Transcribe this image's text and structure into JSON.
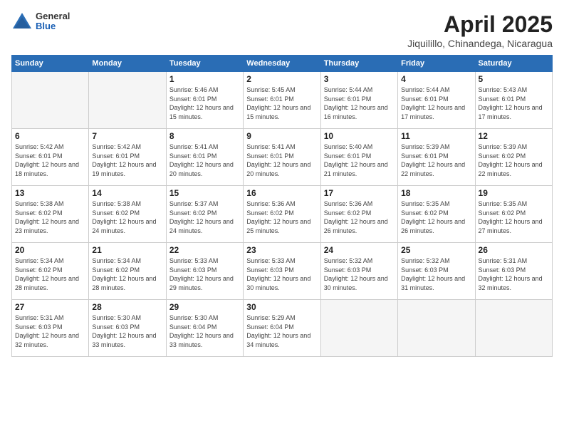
{
  "header": {
    "logo": {
      "general": "General",
      "blue": "Blue"
    },
    "title": "April 2025",
    "location": "Jiquilillo, Chinandega, Nicaragua"
  },
  "weekdays": [
    "Sunday",
    "Monday",
    "Tuesday",
    "Wednesday",
    "Thursday",
    "Friday",
    "Saturday"
  ],
  "weeks": [
    [
      {
        "day": "",
        "sunrise": "",
        "sunset": "",
        "daylight": "",
        "empty": true
      },
      {
        "day": "",
        "sunrise": "",
        "sunset": "",
        "daylight": "",
        "empty": true
      },
      {
        "day": "1",
        "sunrise": "Sunrise: 5:46 AM",
        "sunset": "Sunset: 6:01 PM",
        "daylight": "Daylight: 12 hours and 15 minutes.",
        "empty": false
      },
      {
        "day": "2",
        "sunrise": "Sunrise: 5:45 AM",
        "sunset": "Sunset: 6:01 PM",
        "daylight": "Daylight: 12 hours and 15 minutes.",
        "empty": false
      },
      {
        "day": "3",
        "sunrise": "Sunrise: 5:44 AM",
        "sunset": "Sunset: 6:01 PM",
        "daylight": "Daylight: 12 hours and 16 minutes.",
        "empty": false
      },
      {
        "day": "4",
        "sunrise": "Sunrise: 5:44 AM",
        "sunset": "Sunset: 6:01 PM",
        "daylight": "Daylight: 12 hours and 17 minutes.",
        "empty": false
      },
      {
        "day": "5",
        "sunrise": "Sunrise: 5:43 AM",
        "sunset": "Sunset: 6:01 PM",
        "daylight": "Daylight: 12 hours and 17 minutes.",
        "empty": false
      }
    ],
    [
      {
        "day": "6",
        "sunrise": "Sunrise: 5:42 AM",
        "sunset": "Sunset: 6:01 PM",
        "daylight": "Daylight: 12 hours and 18 minutes.",
        "empty": false
      },
      {
        "day": "7",
        "sunrise": "Sunrise: 5:42 AM",
        "sunset": "Sunset: 6:01 PM",
        "daylight": "Daylight: 12 hours and 19 minutes.",
        "empty": false
      },
      {
        "day": "8",
        "sunrise": "Sunrise: 5:41 AM",
        "sunset": "Sunset: 6:01 PM",
        "daylight": "Daylight: 12 hours and 20 minutes.",
        "empty": false
      },
      {
        "day": "9",
        "sunrise": "Sunrise: 5:41 AM",
        "sunset": "Sunset: 6:01 PM",
        "daylight": "Daylight: 12 hours and 20 minutes.",
        "empty": false
      },
      {
        "day": "10",
        "sunrise": "Sunrise: 5:40 AM",
        "sunset": "Sunset: 6:01 PM",
        "daylight": "Daylight: 12 hours and 21 minutes.",
        "empty": false
      },
      {
        "day": "11",
        "sunrise": "Sunrise: 5:39 AM",
        "sunset": "Sunset: 6:01 PM",
        "daylight": "Daylight: 12 hours and 22 minutes.",
        "empty": false
      },
      {
        "day": "12",
        "sunrise": "Sunrise: 5:39 AM",
        "sunset": "Sunset: 6:02 PM",
        "daylight": "Daylight: 12 hours and 22 minutes.",
        "empty": false
      }
    ],
    [
      {
        "day": "13",
        "sunrise": "Sunrise: 5:38 AM",
        "sunset": "Sunset: 6:02 PM",
        "daylight": "Daylight: 12 hours and 23 minutes.",
        "empty": false
      },
      {
        "day": "14",
        "sunrise": "Sunrise: 5:38 AM",
        "sunset": "Sunset: 6:02 PM",
        "daylight": "Daylight: 12 hours and 24 minutes.",
        "empty": false
      },
      {
        "day": "15",
        "sunrise": "Sunrise: 5:37 AM",
        "sunset": "Sunset: 6:02 PM",
        "daylight": "Daylight: 12 hours and 24 minutes.",
        "empty": false
      },
      {
        "day": "16",
        "sunrise": "Sunrise: 5:36 AM",
        "sunset": "Sunset: 6:02 PM",
        "daylight": "Daylight: 12 hours and 25 minutes.",
        "empty": false
      },
      {
        "day": "17",
        "sunrise": "Sunrise: 5:36 AM",
        "sunset": "Sunset: 6:02 PM",
        "daylight": "Daylight: 12 hours and 26 minutes.",
        "empty": false
      },
      {
        "day": "18",
        "sunrise": "Sunrise: 5:35 AM",
        "sunset": "Sunset: 6:02 PM",
        "daylight": "Daylight: 12 hours and 26 minutes.",
        "empty": false
      },
      {
        "day": "19",
        "sunrise": "Sunrise: 5:35 AM",
        "sunset": "Sunset: 6:02 PM",
        "daylight": "Daylight: 12 hours and 27 minutes.",
        "empty": false
      }
    ],
    [
      {
        "day": "20",
        "sunrise": "Sunrise: 5:34 AM",
        "sunset": "Sunset: 6:02 PM",
        "daylight": "Daylight: 12 hours and 28 minutes.",
        "empty": false
      },
      {
        "day": "21",
        "sunrise": "Sunrise: 5:34 AM",
        "sunset": "Sunset: 6:02 PM",
        "daylight": "Daylight: 12 hours and 28 minutes.",
        "empty": false
      },
      {
        "day": "22",
        "sunrise": "Sunrise: 5:33 AM",
        "sunset": "Sunset: 6:03 PM",
        "daylight": "Daylight: 12 hours and 29 minutes.",
        "empty": false
      },
      {
        "day": "23",
        "sunrise": "Sunrise: 5:33 AM",
        "sunset": "Sunset: 6:03 PM",
        "daylight": "Daylight: 12 hours and 30 minutes.",
        "empty": false
      },
      {
        "day": "24",
        "sunrise": "Sunrise: 5:32 AM",
        "sunset": "Sunset: 6:03 PM",
        "daylight": "Daylight: 12 hours and 30 minutes.",
        "empty": false
      },
      {
        "day": "25",
        "sunrise": "Sunrise: 5:32 AM",
        "sunset": "Sunset: 6:03 PM",
        "daylight": "Daylight: 12 hours and 31 minutes.",
        "empty": false
      },
      {
        "day": "26",
        "sunrise": "Sunrise: 5:31 AM",
        "sunset": "Sunset: 6:03 PM",
        "daylight": "Daylight: 12 hours and 32 minutes.",
        "empty": false
      }
    ],
    [
      {
        "day": "27",
        "sunrise": "Sunrise: 5:31 AM",
        "sunset": "Sunset: 6:03 PM",
        "daylight": "Daylight: 12 hours and 32 minutes.",
        "empty": false
      },
      {
        "day": "28",
        "sunrise": "Sunrise: 5:30 AM",
        "sunset": "Sunset: 6:03 PM",
        "daylight": "Daylight: 12 hours and 33 minutes.",
        "empty": false
      },
      {
        "day": "29",
        "sunrise": "Sunrise: 5:30 AM",
        "sunset": "Sunset: 6:04 PM",
        "daylight": "Daylight: 12 hours and 33 minutes.",
        "empty": false
      },
      {
        "day": "30",
        "sunrise": "Sunrise: 5:29 AM",
        "sunset": "Sunset: 6:04 PM",
        "daylight": "Daylight: 12 hours and 34 minutes.",
        "empty": false
      },
      {
        "day": "",
        "sunrise": "",
        "sunset": "",
        "daylight": "",
        "empty": true
      },
      {
        "day": "",
        "sunrise": "",
        "sunset": "",
        "daylight": "",
        "empty": true
      },
      {
        "day": "",
        "sunrise": "",
        "sunset": "",
        "daylight": "",
        "empty": true
      }
    ]
  ]
}
